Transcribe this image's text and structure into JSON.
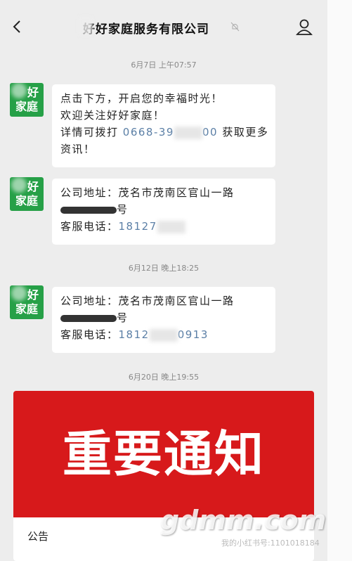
{
  "header": {
    "title": "好好家庭服务有限公司",
    "back_icon": "chevron-left-icon",
    "mute_icon": "bell-muted-icon",
    "profile_icon": "user-icon"
  },
  "avatar": {
    "top": "好",
    "bottom": "家庭"
  },
  "timestamps": [
    "6月7日 上午07:57",
    "6月12日 晚上18:25",
    "6月20日 晚上19:55"
  ],
  "messages": [
    {
      "line1": "点击下方，开启您的幸福时光！",
      "line2": "欢迎关注好好家庭！",
      "line3_prefix": "详情可拨打",
      "line3_phone_start": "0668-39",
      "line3_phone_end": "00",
      "line3_suffix": "获取更多",
      "line4": "资讯！"
    },
    {
      "address_label": "公司地址：",
      "address": "茂名市茂南区官山一路",
      "address_tail": "号",
      "phone_label": "客服电话：",
      "phone_start": "18127",
      "phone_end": ""
    },
    {
      "address_label": "公司地址：",
      "address": "茂名市茂南区官山一路",
      "address_tail": "号",
      "phone_label": "客服电话：",
      "phone_start": "1812",
      "phone_end": "0913"
    }
  ],
  "card": {
    "banner_text": "重要通知",
    "label": "公告"
  },
  "watermark": {
    "main": "gdmm.com",
    "sub": "我的小红书号:1101018184"
  },
  "colors": {
    "avatar_green": "#26a047",
    "banner_red": "#d7191b",
    "link_blue": "#5b7fa6"
  }
}
